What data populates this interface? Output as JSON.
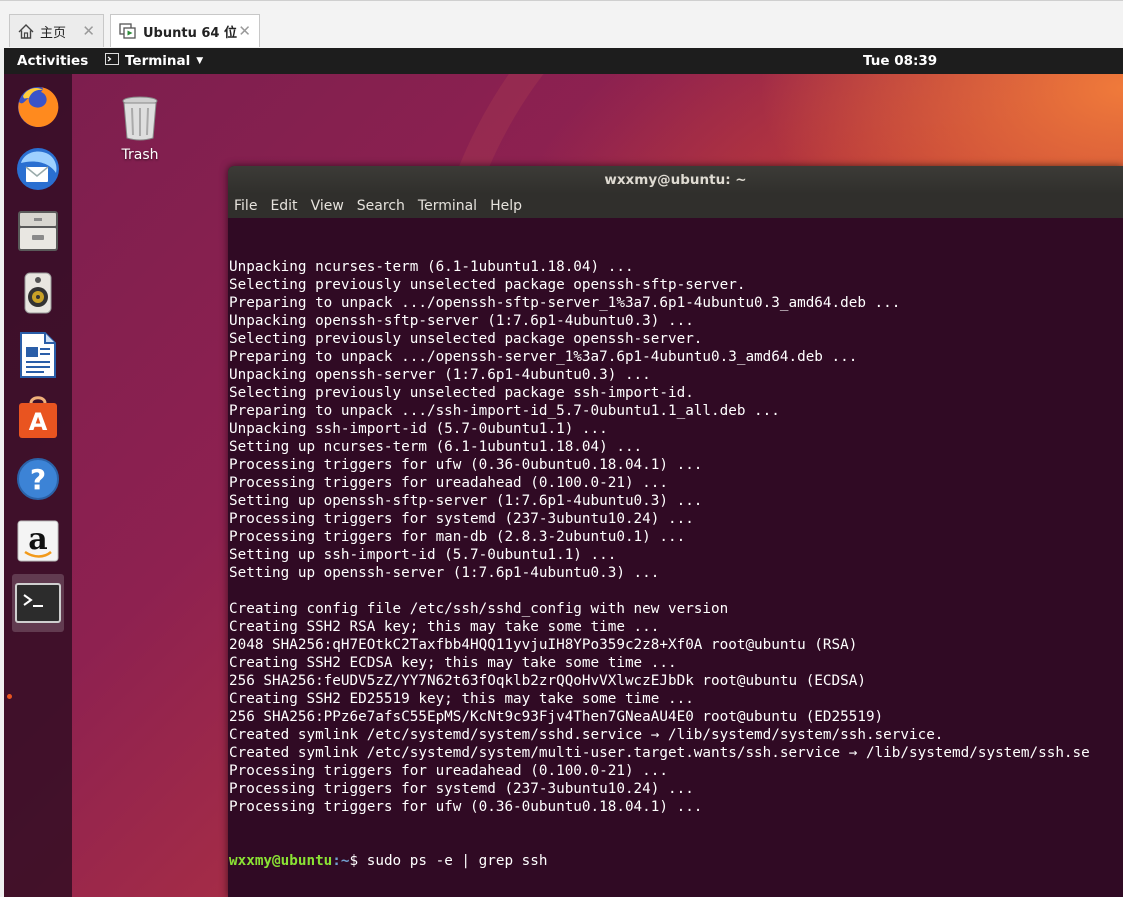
{
  "host_tabs": [
    {
      "label": "主页",
      "icon": "home-icon",
      "active": false
    },
    {
      "label": "Ubuntu 64 位",
      "icon": "vm-icon",
      "active": true
    }
  ],
  "topbar": {
    "activities": "Activities",
    "app_menu": "Terminal",
    "clock": "Tue 08:39"
  },
  "dock": {
    "items": [
      "firefox-icon",
      "thunderbird-icon",
      "files-icon",
      "rhythmbox-icon",
      "libreoffice-writer-icon",
      "ubuntu-software-icon",
      "help-icon",
      "amazon-icon",
      "terminal-icon"
    ],
    "accent": "#e95420"
  },
  "desktop": {
    "trash_label": "Trash"
  },
  "terminal": {
    "title": "wxxmy@ubuntu: ~",
    "menu": [
      "File",
      "Edit",
      "View",
      "Search",
      "Terminal",
      "Help"
    ],
    "lines": [
      "Unpacking ncurses-term (6.1-1ubuntu1.18.04) ...",
      "Selecting previously unselected package openssh-sftp-server.",
      "Preparing to unpack .../openssh-sftp-server_1%3a7.6p1-4ubuntu0.3_amd64.deb ...",
      "Unpacking openssh-sftp-server (1:7.6p1-4ubuntu0.3) ...",
      "Selecting previously unselected package openssh-server.",
      "Preparing to unpack .../openssh-server_1%3a7.6p1-4ubuntu0.3_amd64.deb ...",
      "Unpacking openssh-server (1:7.6p1-4ubuntu0.3) ...",
      "Selecting previously unselected package ssh-import-id.",
      "Preparing to unpack .../ssh-import-id_5.7-0ubuntu1.1_all.deb ...",
      "Unpacking ssh-import-id (5.7-0ubuntu1.1) ...",
      "Setting up ncurses-term (6.1-1ubuntu1.18.04) ...",
      "Processing triggers for ufw (0.36-0ubuntu0.18.04.1) ...",
      "Processing triggers for ureadahead (0.100.0-21) ...",
      "Setting up openssh-sftp-server (1:7.6p1-4ubuntu0.3) ...",
      "Processing triggers for systemd (237-3ubuntu10.24) ...",
      "Processing triggers for man-db (2.8.3-2ubuntu0.1) ...",
      "Setting up ssh-import-id (5.7-0ubuntu1.1) ...",
      "Setting up openssh-server (1:7.6p1-4ubuntu0.3) ...",
      "",
      "Creating config file /etc/ssh/sshd_config with new version",
      "Creating SSH2 RSA key; this may take some time ...",
      "2048 SHA256:qH7EOtkC2Taxfbb4HQQ11yvjuIH8YPo359c2z8+Xf0A root@ubuntu (RSA)",
      "Creating SSH2 ECDSA key; this may take some time ...",
      "256 SHA256:feUDV5zZ/YY7N62t63fOqklb2zrQQoHvVXlwczEJbDk root@ubuntu (ECDSA)",
      "Creating SSH2 ED25519 key; this may take some time ...",
      "256 SHA256:PPz6e7afsC55EpMS/KcNt9c93Fjv4Then7GNeaAU4E0 root@ubuntu (ED25519)",
      "Created symlink /etc/systemd/system/sshd.service → /lib/systemd/system/ssh.service.",
      "Created symlink /etc/systemd/system/multi-user.target.wants/ssh.service → /lib/systemd/system/ssh.se",
      "Processing triggers for ureadahead (0.100.0-21) ...",
      "Processing triggers for systemd (237-3ubuntu10.24) ...",
      "Processing triggers for ufw (0.36-0ubuntu0.18.04.1) ..."
    ],
    "prompt": {
      "user": "wxxmy@ubuntu",
      "path": ":~",
      "symbol": "$ ",
      "command": "sudo ps -e | grep ssh"
    }
  }
}
